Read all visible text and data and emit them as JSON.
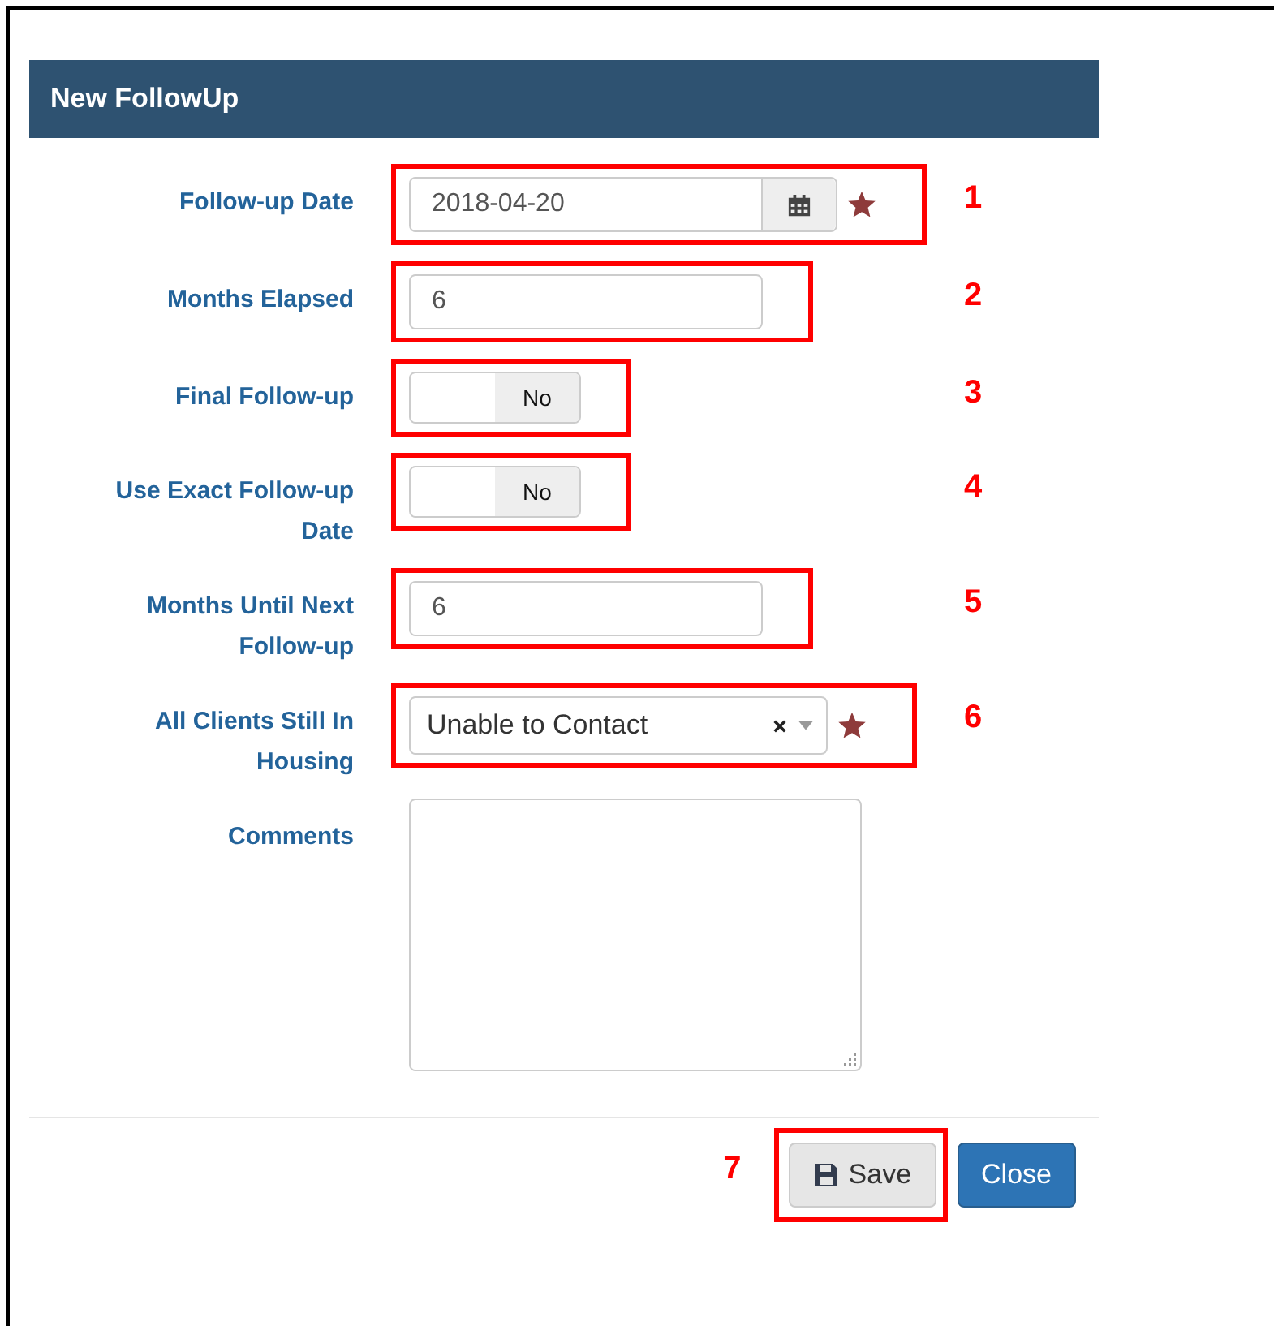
{
  "dialog": {
    "title": "New FollowUp"
  },
  "fields": [
    {
      "kind": "date",
      "label": "Follow-up Date",
      "value": "2018-04-20",
      "required": true,
      "callout": "1"
    },
    {
      "kind": "text",
      "label": "Months Elapsed",
      "value": "6",
      "required": false,
      "callout": "2"
    },
    {
      "kind": "toggle",
      "label": "Final Follow-up",
      "on": false,
      "state_label": "No",
      "callout": "3"
    },
    {
      "kind": "toggle",
      "label": "Use Exact Follow-up Date",
      "on": false,
      "state_label": "No",
      "callout": "4"
    },
    {
      "kind": "text",
      "label": "Months Until Next Follow-up",
      "value": "6",
      "required": false,
      "callout": "5"
    },
    {
      "kind": "select",
      "label": "All Clients Still In Housing",
      "value": "Unable to Contact",
      "required": true,
      "callout": "6"
    },
    {
      "kind": "textarea",
      "label": "Comments"
    }
  ],
  "buttons": [
    {
      "kind": "default",
      "label": "Save",
      "callout": "7"
    },
    {
      "kind": "primary",
      "label": "Close"
    }
  ]
}
